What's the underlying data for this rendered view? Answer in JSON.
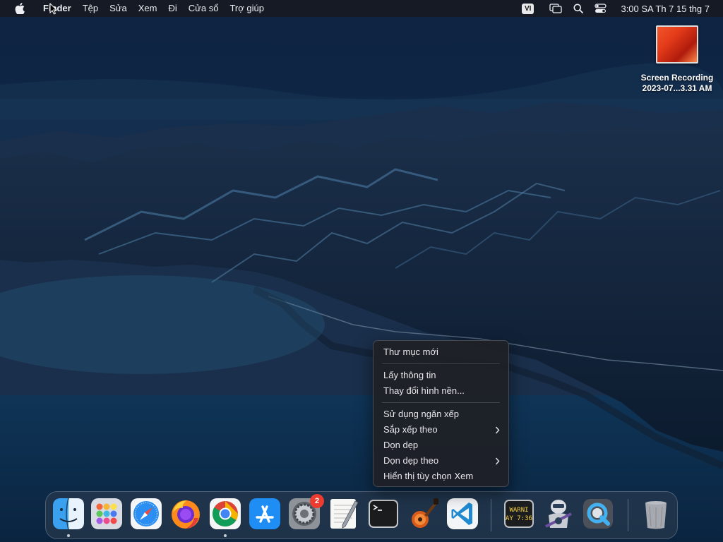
{
  "menubar": {
    "app_name": "Finder",
    "menus": [
      "Tệp",
      "Sửa",
      "Xem",
      "Đi",
      "Cửa sổ",
      "Trợ giúp"
    ],
    "input_source": "VI",
    "clock": "3:00 SA Th 7 15 thg 7",
    "icons": [
      "apple-icon",
      "window-switch-icon",
      "search-icon",
      "control-center-icon"
    ]
  },
  "desktop": {
    "file": {
      "name_line1": "Screen Recording",
      "name_line2": "2023-07...3.31 AM"
    }
  },
  "context_menu": {
    "items": [
      {
        "label": "Thư mục mới"
      },
      {
        "label": "Lấy thông tin"
      },
      {
        "label": "Thay đổi hình nền..."
      },
      {
        "label": "Sử dụng ngăn xếp"
      },
      {
        "label": "Sắp xếp theo",
        "submenu": true
      },
      {
        "label": "Dọn dẹp"
      },
      {
        "label": "Dọn dẹp theo",
        "submenu": true
      },
      {
        "label": "Hiển thị tùy chọn Xem"
      }
    ]
  },
  "dock": {
    "apps": [
      {
        "name": "Finder",
        "icon": "finder-icon",
        "running": true
      },
      {
        "name": "Launchpad",
        "icon": "launchpad-icon"
      },
      {
        "name": "Safari",
        "icon": "safari-icon"
      },
      {
        "name": "Firefox",
        "icon": "firefox-icon"
      },
      {
        "name": "Google Chrome",
        "icon": "chrome-icon",
        "running": true
      },
      {
        "name": "App Store",
        "icon": "app-store-icon"
      },
      {
        "name": "System Settings",
        "icon": "settings-icon",
        "badge": "2"
      },
      {
        "name": "TextEdit",
        "icon": "textedit-icon"
      },
      {
        "name": "Terminal",
        "icon": "terminal-icon"
      },
      {
        "name": "GarageBand",
        "icon": "garageband-icon"
      },
      {
        "name": "Visual Studio Code",
        "icon": "vscode-icon"
      },
      {
        "name": "Console",
        "icon": "console-icon",
        "text_line1": "WARNI",
        "text_line2": "AY 7:36"
      },
      {
        "name": "Automator",
        "icon": "automator-icon"
      },
      {
        "name": "QuickTime Player",
        "icon": "quicktime-icon"
      },
      {
        "name": "Trash",
        "icon": "trash-icon"
      }
    ]
  }
}
